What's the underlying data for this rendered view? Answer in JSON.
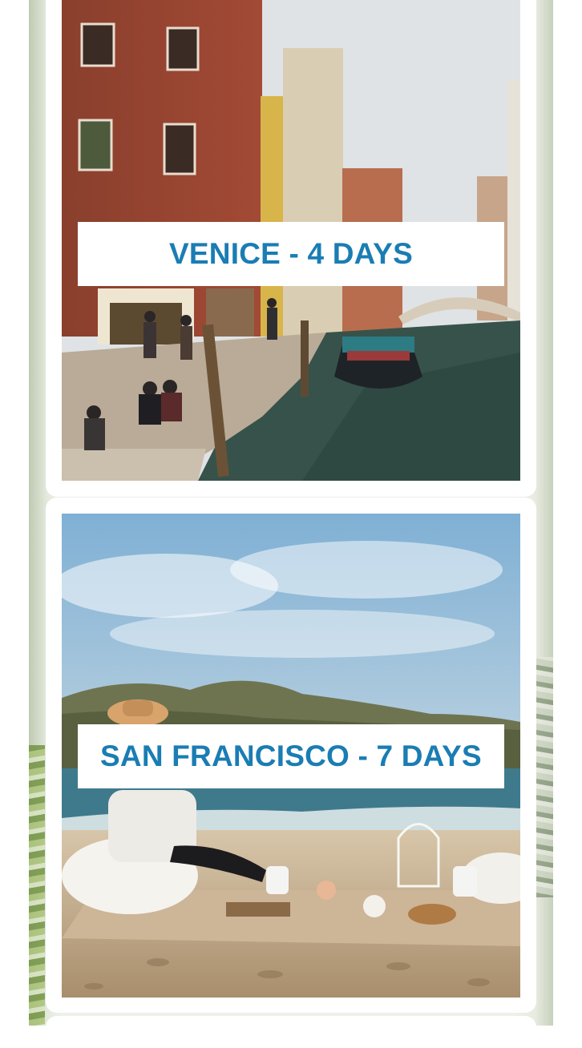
{
  "destinations": [
    {
      "title": "VENICE - 4 DAYS",
      "image": "venice-canal-photo"
    },
    {
      "title": "SAN FRANCISCO - 7 DAYS",
      "image": "san-francisco-beach-picnic-photo"
    }
  ],
  "colors": {
    "label_text": "#1a7db3",
    "card_bg": "#ffffff"
  }
}
